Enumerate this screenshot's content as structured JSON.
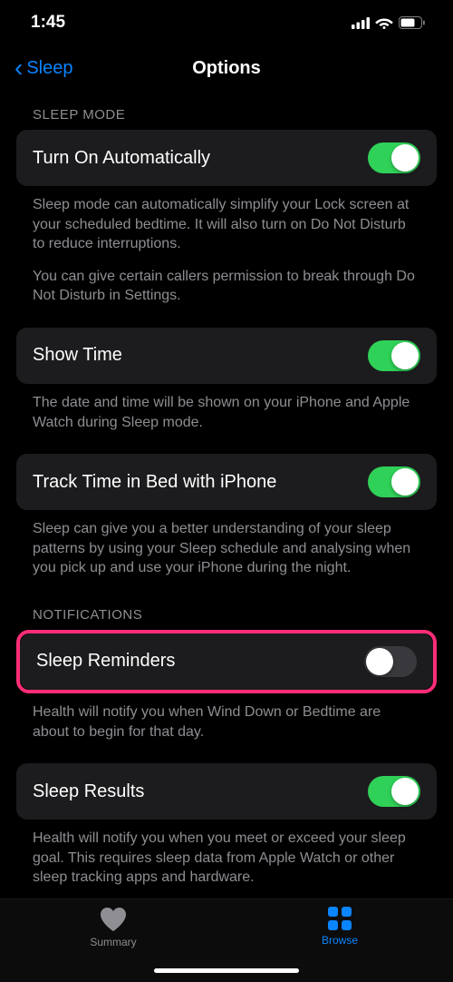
{
  "statusBar": {
    "time": "1:45"
  },
  "nav": {
    "back": "Sleep",
    "title": "Options"
  },
  "sections": {
    "sleepMode": {
      "header": "SLEEP MODE",
      "turnOn": {
        "label": "Turn On Automatically",
        "desc1": "Sleep mode can automatically simplify your Lock screen at your scheduled bedtime. It will also turn on Do Not Disturb to reduce interruptions.",
        "desc2": "You can give certain callers permission to break through Do Not Disturb in Settings."
      },
      "showTime": {
        "label": "Show Time",
        "desc": "The date and time will be shown on your iPhone and Apple Watch during Sleep mode."
      },
      "trackTime": {
        "label": "Track Time in Bed with iPhone",
        "desc": "Sleep can give you a better understanding of your sleep patterns by using your Sleep schedule and analysing when you pick up and use your iPhone during the night."
      }
    },
    "notifications": {
      "header": "NOTIFICATIONS",
      "sleepReminders": {
        "label": "Sleep Reminders",
        "desc": "Health will notify you when Wind Down or Bedtime are about to begin for that day."
      },
      "sleepResults": {
        "label": "Sleep Results",
        "desc": "Health will notify you when you meet or exceed your sleep goal. This requires sleep data from Apple Watch or other sleep tracking apps and hardware."
      }
    }
  },
  "tabs": {
    "summary": "Summary",
    "browse": "Browse"
  }
}
